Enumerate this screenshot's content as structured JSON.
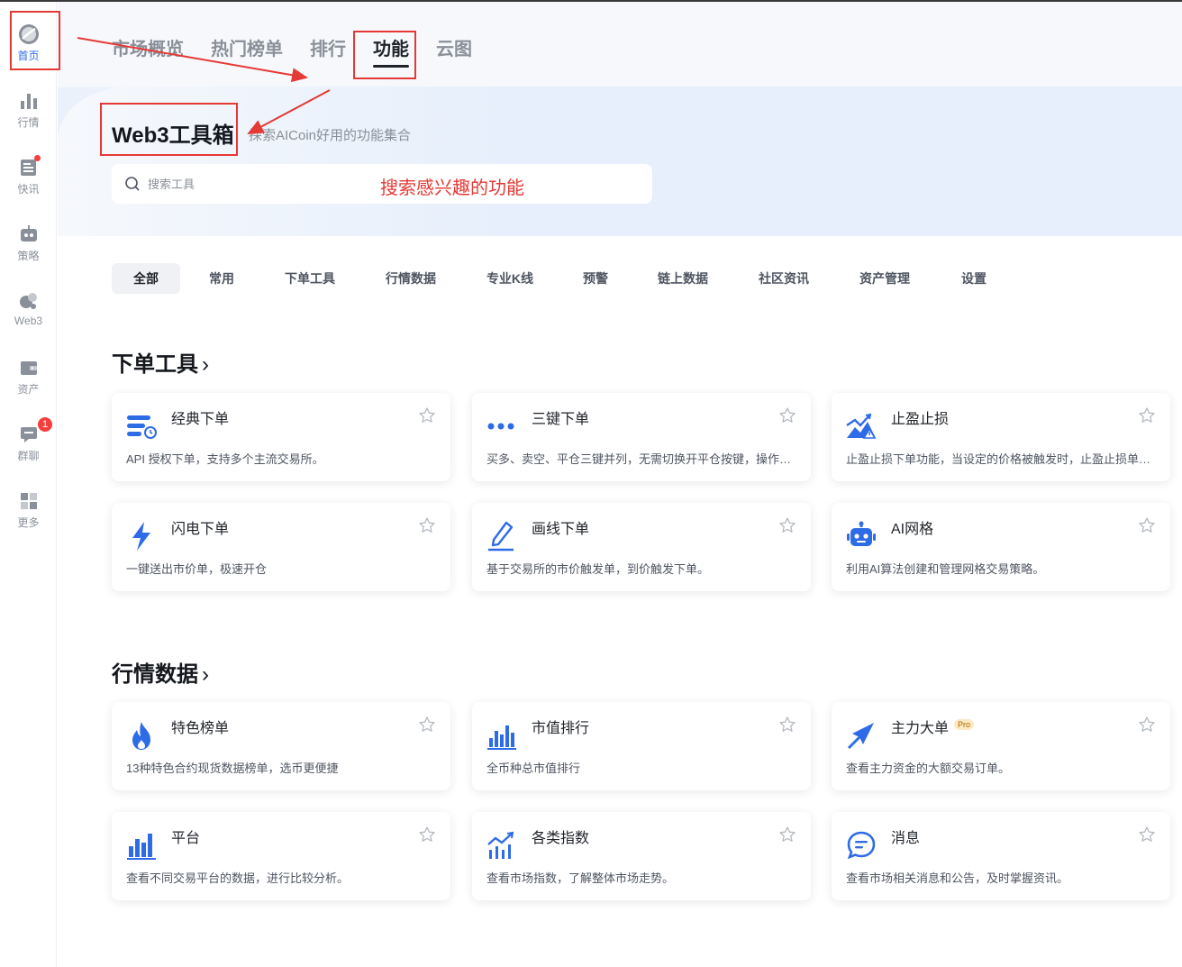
{
  "sidebar": {
    "items": [
      {
        "label": "首页",
        "icon": "home-logo-icon",
        "active": true
      },
      {
        "label": "行情",
        "icon": "bar-chart-icon"
      },
      {
        "label": "快讯",
        "icon": "news-icon",
        "dot": true
      },
      {
        "label": "策略",
        "icon": "robot-icon"
      },
      {
        "label": "Web3",
        "icon": "web3-icon"
      },
      {
        "label": "资产",
        "icon": "wallet-icon"
      },
      {
        "label": "群聊",
        "icon": "chat-icon",
        "badge": "1"
      },
      {
        "label": "更多",
        "icon": "grid-icon"
      }
    ]
  },
  "top_tabs": [
    "市场概览",
    "热门榜单",
    "排行",
    "功能",
    "云图"
  ],
  "active_top_tab": "功能",
  "hero": {
    "title": "Web3工具箱",
    "subtitle": "探索AICoin好用的功能集合",
    "search_placeholder": "搜索工具"
  },
  "annotation": {
    "search_hint": "搜索感兴趣的功能",
    "color": "#e53935"
  },
  "categories": [
    "全部",
    "常用",
    "下单工具",
    "行情数据",
    "专业K线",
    "预警",
    "链上数据",
    "社区资讯",
    "资产管理",
    "设置"
  ],
  "active_category": "全部",
  "sections": [
    {
      "title": "下单工具",
      "cards": [
        {
          "title": "经典下单",
          "desc": "API 授权下单，支持多个主流交易所。",
          "icon": "classic-order-icon"
        },
        {
          "title": "三键下单",
          "desc": "买多、卖空、平仓三键并列，无需切换开平仓按键，操作更便捷。",
          "icon": "three-dots-icon"
        },
        {
          "title": "止盈止损",
          "desc": "止盈止损下单功能，当设定的价格被触发时，止盈止损单自动执行。",
          "icon": "take-profit-icon"
        },
        {
          "title": "闪电下单",
          "desc": "一键送出市价单，极速开仓",
          "icon": "lightning-icon"
        },
        {
          "title": "画线下单",
          "desc": "基于交易所的市价触发单，到价触发下单。",
          "icon": "pen-icon"
        },
        {
          "title": "AI网格",
          "desc": "利用AI算法创建和管理网格交易策略。",
          "icon": "ai-robot-icon"
        }
      ]
    },
    {
      "title": "行情数据",
      "cards": [
        {
          "title": "特色榜单",
          "desc": "13种特色合约现货数据榜单，选币更便捷",
          "icon": "flame-icon"
        },
        {
          "title": "市值排行",
          "desc": "全币种总市值排行",
          "icon": "market-cap-icon"
        },
        {
          "title": "主力大单",
          "desc": "查看主力资金的大额交易订单。",
          "icon": "compass-icon",
          "pro": "Pro"
        },
        {
          "title": "平台",
          "desc": "查看不同交易平台的数据，进行比较分析。",
          "icon": "platform-chart-icon"
        },
        {
          "title": "各类指数",
          "desc": "查看市场指数，了解整体市场走势。",
          "icon": "index-chart-icon"
        },
        {
          "title": "消息",
          "desc": "查看市场相关消息和公告，及时掌握资讯。",
          "icon": "message-icon"
        }
      ]
    }
  ]
}
